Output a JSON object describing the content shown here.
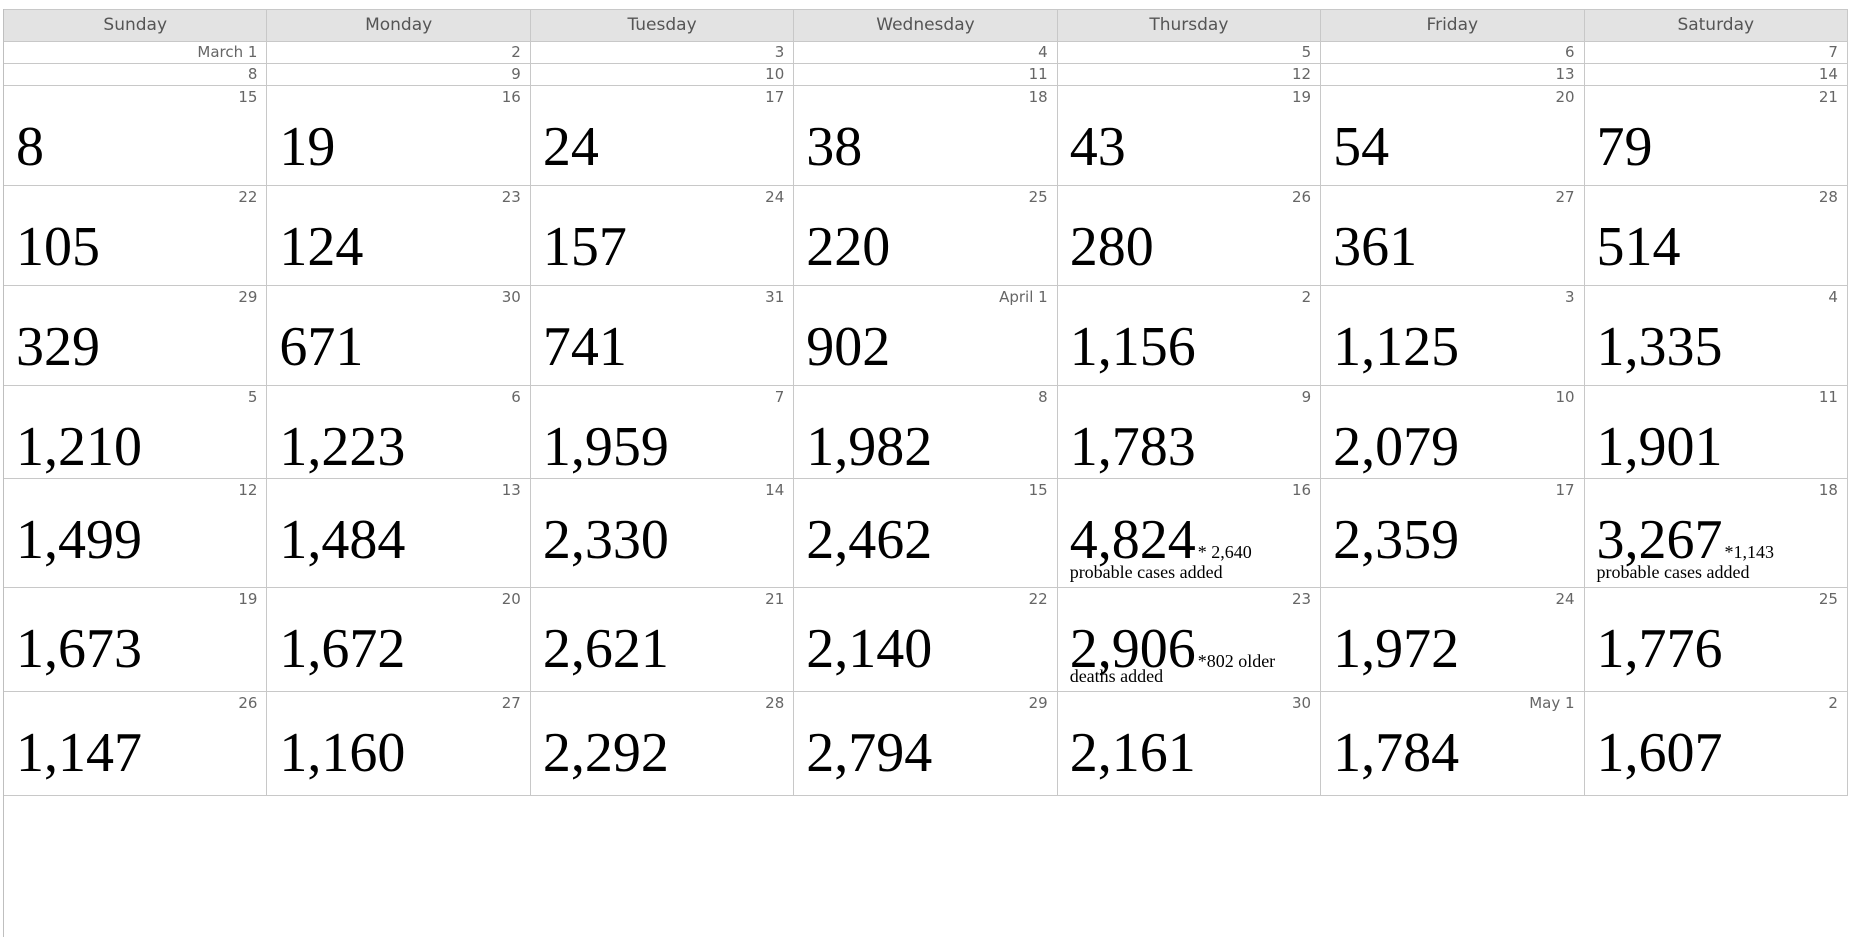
{
  "weekdays": [
    "Sunday",
    "Monday",
    "Tuesday",
    "Wednesday",
    "Thursday",
    "Friday",
    "Saturday"
  ],
  "weeks": [
    {
      "days": [
        {
          "label": "March 1",
          "count": ""
        },
        {
          "label": "2",
          "count": ""
        },
        {
          "label": "3",
          "count": ""
        },
        {
          "label": "4",
          "count": ""
        },
        {
          "label": "5",
          "count": ""
        },
        {
          "label": "6",
          "count": ""
        },
        {
          "label": "7",
          "count": ""
        }
      ]
    },
    {
      "days": [
        {
          "label": "8",
          "count": ""
        },
        {
          "label": "9",
          "count": ""
        },
        {
          "label": "10",
          "count": ""
        },
        {
          "label": "11",
          "count": ""
        },
        {
          "label": "12",
          "count": ""
        },
        {
          "label": "13",
          "count": ""
        },
        {
          "label": "14",
          "count": ""
        }
      ]
    },
    {
      "days": [
        {
          "label": "15",
          "count": "8"
        },
        {
          "label": "16",
          "count": "19"
        },
        {
          "label": "17",
          "count": "24"
        },
        {
          "label": "18",
          "count": "38"
        },
        {
          "label": "19",
          "count": "43"
        },
        {
          "label": "20",
          "count": "54"
        },
        {
          "label": "21",
          "count": "79"
        }
      ]
    },
    {
      "days": [
        {
          "label": "22",
          "count": "105"
        },
        {
          "label": "23",
          "count": "124"
        },
        {
          "label": "24",
          "count": "157"
        },
        {
          "label": "25",
          "count": "220"
        },
        {
          "label": "26",
          "count": "280"
        },
        {
          "label": "27",
          "count": "361"
        },
        {
          "label": "28",
          "count": "514"
        }
      ]
    },
    {
      "days": [
        {
          "label": "29",
          "count": "329"
        },
        {
          "label": "30",
          "count": "671"
        },
        {
          "label": "31",
          "count": "741"
        },
        {
          "label": "April 1",
          "count": "902"
        },
        {
          "label": "2",
          "count": "1,156"
        },
        {
          "label": "3",
          "count": "1,125"
        },
        {
          "label": "4",
          "count": "1,335"
        }
      ]
    },
    {
      "days": [
        {
          "label": "5",
          "count": "1,210"
        },
        {
          "label": "6",
          "count": "1,223"
        },
        {
          "label": "7",
          "count": "1,959"
        },
        {
          "label": "8",
          "count": "1,982"
        },
        {
          "label": "9",
          "count": "1,783"
        },
        {
          "label": "10",
          "count": "2,079"
        },
        {
          "label": "11",
          "count": "1,901"
        }
      ]
    },
    {
      "days": [
        {
          "label": "12",
          "count": "1,499"
        },
        {
          "label": "13",
          "count": "1,484"
        },
        {
          "label": "14",
          "count": "2,330"
        },
        {
          "label": "15",
          "count": "2,462"
        },
        {
          "label": "16",
          "count": "4,824",
          "note_inline": "* 2,640",
          "note_line": "probable cases added"
        },
        {
          "label": "17",
          "count": "2,359"
        },
        {
          "label": "18",
          "count": "3,267",
          "note_inline": "*1,143",
          "note_line": "probable cases added"
        }
      ]
    },
    {
      "days": [
        {
          "label": "19",
          "count": "1,673"
        },
        {
          "label": "20",
          "count": "1,672"
        },
        {
          "label": "21",
          "count": "2,621"
        },
        {
          "label": "22",
          "count": "2,140"
        },
        {
          "label": "23",
          "count": "2,906",
          "note_inline": "*802 older",
          "note_line": "deaths added"
        },
        {
          "label": "24",
          "count": "1,972"
        },
        {
          "label": "25",
          "count": "1,776"
        }
      ]
    },
    {
      "days": [
        {
          "label": "26",
          "count": "1,147"
        },
        {
          "label": "27",
          "count": "1,160"
        },
        {
          "label": "28",
          "count": "2,292"
        },
        {
          "label": "29",
          "count": "2,794"
        },
        {
          "label": "30",
          "count": "2,161"
        },
        {
          "label": "May 1",
          "count": "1,784"
        },
        {
          "label": "2",
          "count": "1,607"
        }
      ]
    }
  ]
}
